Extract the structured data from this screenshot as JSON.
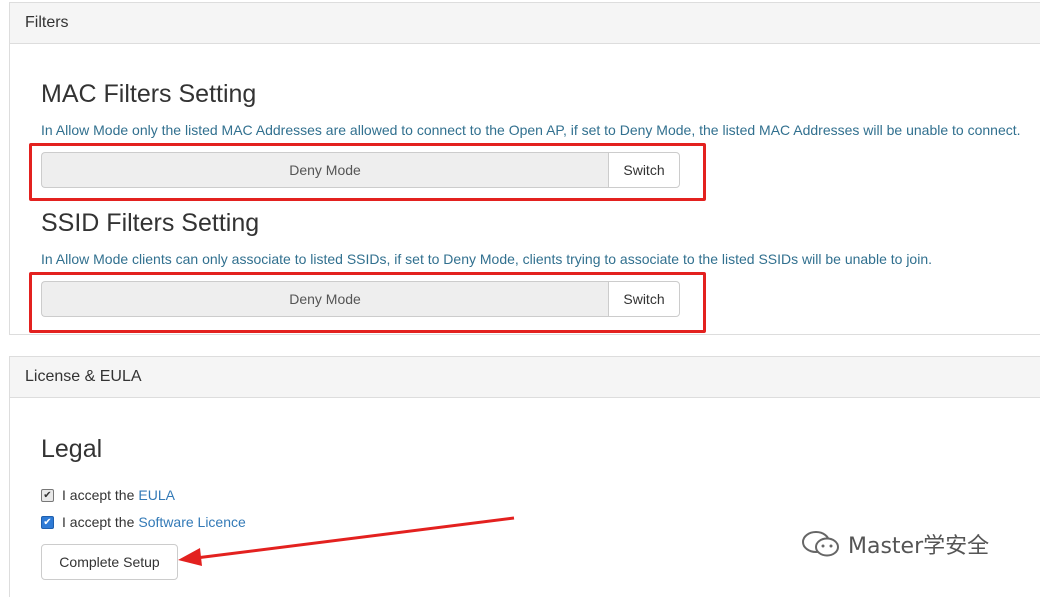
{
  "filters_panel": {
    "heading": "Filters",
    "mac": {
      "title": "MAC Filters Setting",
      "help": "In Allow Mode only the listed MAC Addresses are allowed to connect to the Open AP, if set to Deny Mode, the listed MAC Addresses will be unable to connect.",
      "mode_value": "Deny Mode",
      "switch_label": "Switch"
    },
    "ssid": {
      "title": "SSID Filters Setting",
      "help": "In Allow Mode clients can only associate to listed SSIDs, if set to Deny Mode, clients trying to associate to the listed SSIDs will be unable to join.",
      "mode_value": "Deny Mode",
      "switch_label": "Switch"
    }
  },
  "license_panel": {
    "heading": "License & EULA",
    "legal_title": "Legal",
    "eula": {
      "prefix": "I accept the",
      "link": "EULA",
      "checked": true
    },
    "licence": {
      "prefix": "I accept the",
      "link": "Software Licence",
      "checked": true
    },
    "complete_button": "Complete Setup"
  },
  "watermark": {
    "text": "Master学安全"
  },
  "colors": {
    "highlight": "#e3211f",
    "help_text": "#31708f",
    "link": "#337ab7"
  }
}
